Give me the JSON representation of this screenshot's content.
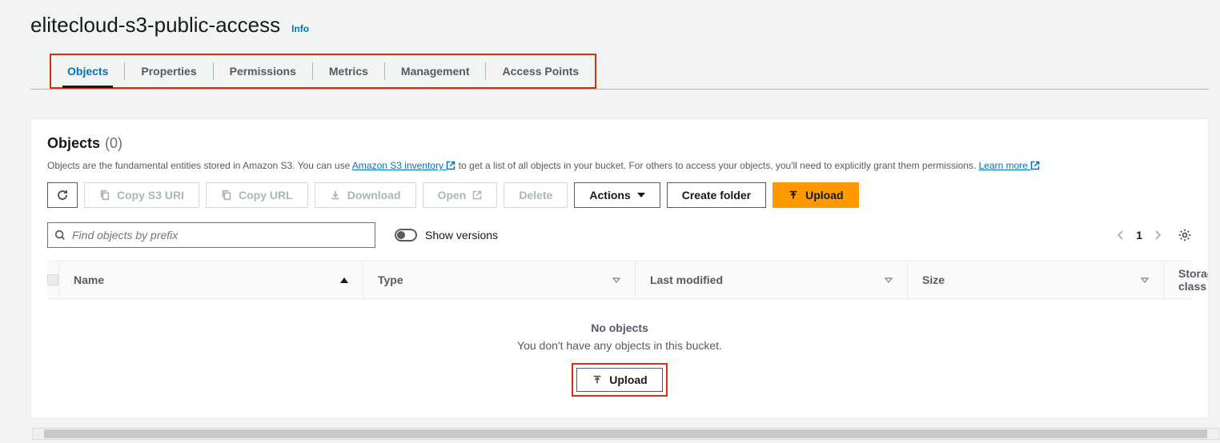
{
  "header": {
    "bucket_name": "elitecloud-s3-public-access",
    "info_label": "Info"
  },
  "tabs": {
    "items": [
      "Objects",
      "Properties",
      "Permissions",
      "Metrics",
      "Management",
      "Access Points"
    ],
    "active_index": 0
  },
  "objects": {
    "title": "Objects",
    "count_display": "(0)",
    "desc_prefix": "Objects are the fundamental entities stored in Amazon S3. You can use ",
    "desc_link1": "Amazon S3 inventory ",
    "desc_mid": " to get a list of all objects in your bucket. For others to access your objects, you'll need to explicitly grant them permissions. ",
    "desc_link2": "Learn more "
  },
  "toolbar": {
    "copy_s3": "Copy S3 URI",
    "copy_url": "Copy URL",
    "download": "Download",
    "open": "Open",
    "delete": "Delete",
    "actions": "Actions",
    "create_folder": "Create folder",
    "upload": "Upload"
  },
  "filter": {
    "search_placeholder": "Find objects by prefix",
    "show_versions": "Show versions",
    "page_number": "1"
  },
  "table": {
    "columns": {
      "name": "Name",
      "type": "Type",
      "last_modified": "Last modified",
      "size": "Size",
      "storage_class": "Storage class"
    }
  },
  "empty": {
    "title": "No objects",
    "subtitle": "You don't have any objects in this bucket.",
    "upload": "Upload"
  }
}
